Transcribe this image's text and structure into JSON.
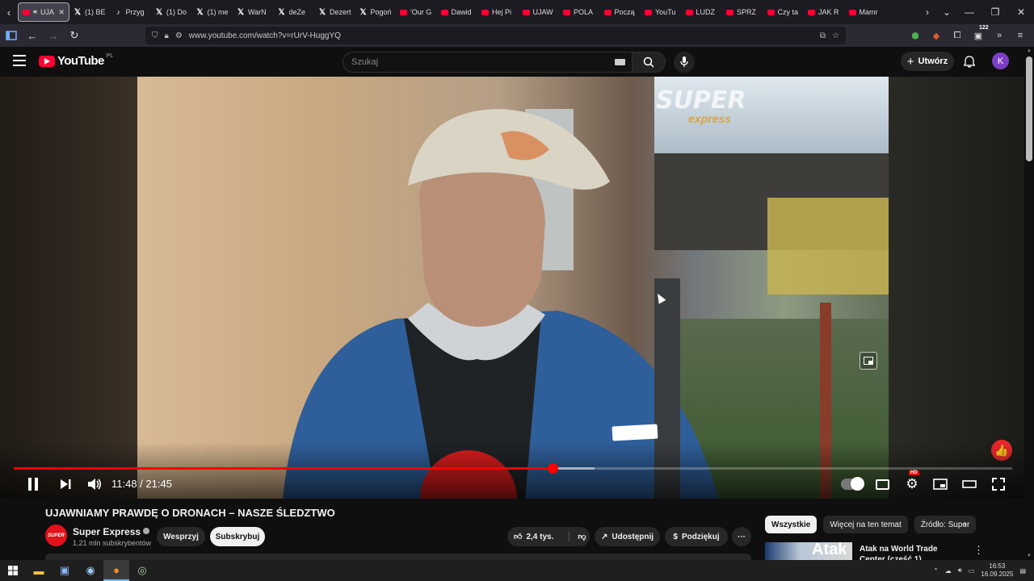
{
  "browser": {
    "tabs": [
      {
        "label": "UJA",
        "icon": "youtube-icon",
        "active": true
      },
      {
        "label": "(1) BE",
        "icon": "x-icon"
      },
      {
        "label": "Przyg",
        "icon": "tiktok-icon"
      },
      {
        "label": "(1) Do",
        "icon": "x-icon"
      },
      {
        "label": "(1) me",
        "icon": "x-icon"
      },
      {
        "label": "WarN",
        "icon": "x-icon"
      },
      {
        "label": "deZe",
        "icon": "x-icon"
      },
      {
        "label": "Dezert",
        "icon": "x-icon"
      },
      {
        "label": "Pogoń",
        "icon": "x-icon"
      },
      {
        "label": "'Our G",
        "icon": "youtube-icon"
      },
      {
        "label": "Dawid",
        "icon": "youtube-icon"
      },
      {
        "label": "Hej Pi",
        "icon": "youtube-icon"
      },
      {
        "label": "UJAW",
        "icon": "youtube-icon"
      },
      {
        "label": "POLA",
        "icon": "youtube-icon"
      },
      {
        "label": "Począ",
        "icon": "youtube-icon"
      },
      {
        "label": "YouTu",
        "icon": "youtube-icon"
      },
      {
        "label": "LUDZ",
        "icon": "youtube-icon"
      },
      {
        "label": "SPRZ",
        "icon": "youtube-icon"
      },
      {
        "label": "Czy ta",
        "icon": "youtube-icon"
      },
      {
        "label": "JAK R",
        "icon": "youtube-icon"
      },
      {
        "label": "Mamr",
        "icon": "youtube-icon"
      }
    ],
    "url": "www.youtube.com/watch?v=rUrV-HuggYQ",
    "extension_badge": "122"
  },
  "youtube": {
    "logo_text": "YouTube",
    "country_code": "PL",
    "search_placeholder": "Szukaj",
    "create_label": "Utwórz",
    "avatar_letter": "K"
  },
  "player": {
    "watermark_top": "SUPER",
    "watermark_bottom": "express",
    "current_time": "11:48",
    "duration": "21:45",
    "time_display": "11:48 / 21:45",
    "played_fraction": 0.54,
    "buffered_fraction": 0.582,
    "hd_badge": "HD"
  },
  "video": {
    "title": "UJAWNIAMY PRAWDĘ O DRONACH – NASZE ŚLEDZTWO",
    "channel_name": "Super Express",
    "subscribers": "1,21 mln subskrybentów",
    "channel_avatar_text": "SUPER",
    "support_label": "Wesprzyj",
    "subscribe_label": "Subskrybuj",
    "likes": "2,4 tys.",
    "share_label": "Udostępnij",
    "thanks_label": "Podziękuj",
    "more_label": "···"
  },
  "sidebar": {
    "chips": [
      "Wszystkie",
      "Więcej na ten temat",
      "Źródło: Super"
    ],
    "rec_thumb_text": "Atak",
    "rec_title": "Atak na World Trade Center (część 1)"
  },
  "taskbar": {
    "time": "16:53",
    "date": "16.09.2025"
  }
}
